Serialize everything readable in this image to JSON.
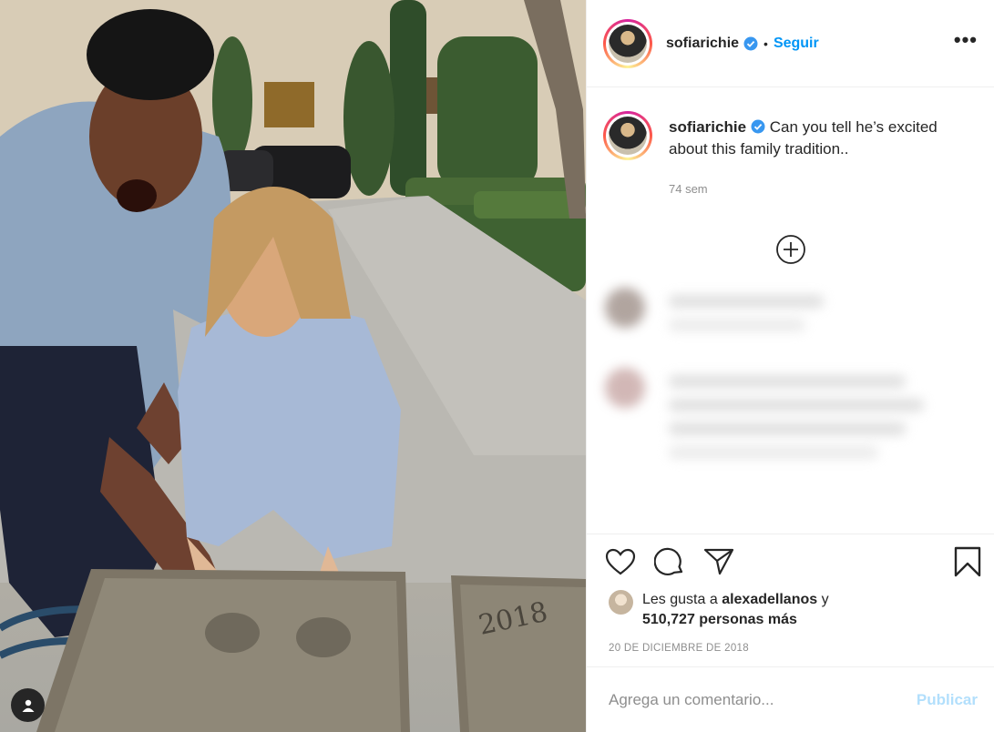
{
  "post": {
    "username": "sofiarichie",
    "follow_label": "Seguir",
    "more_label": "•••",
    "separator": "•",
    "caption_text": "Can you tell he’s excited about this family tradition..",
    "caption_time": "74 sem",
    "likes_prefix": "Les gusta a",
    "likes_user": "alexadellanos",
    "likes_conjunction": "y",
    "likes_count": "510,727 personas más",
    "date": "20 DE DICIEMBRE DE 2018",
    "comment_placeholder": "Agrega un comentario...",
    "publish_label": "Publicar"
  },
  "photo": {
    "slab_text_left": "2018"
  },
  "colors": {
    "link_blue": "#0095f6",
    "publish_disabled": "#b2dffc",
    "verified_blue": "#3897f0",
    "secondary_text": "#8e8e8e"
  },
  "icons": [
    "verified-badge-icon",
    "more-options-icon",
    "load-more-icon",
    "heart-icon",
    "comment-icon",
    "share-icon",
    "bookmark-icon",
    "user-tag-icon"
  ]
}
